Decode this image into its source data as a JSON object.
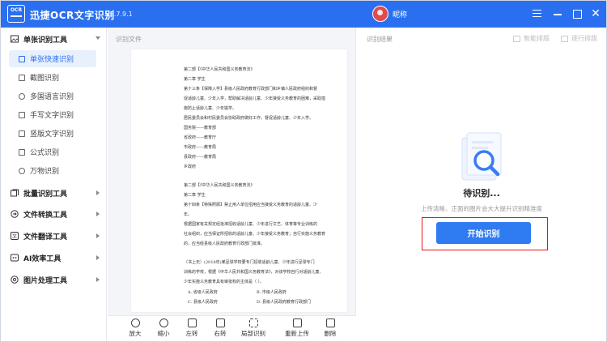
{
  "titlebar": {
    "logo_text": "OCR",
    "title": "迅捷OCR文字识别",
    "version": "v8.7.9.1",
    "nickname": "昵称",
    "controls": [
      "menu-icon",
      "minimize-icon",
      "maximize-icon",
      "close-icon"
    ]
  },
  "sidebar": {
    "groups": [
      {
        "label": "单张识别工具",
        "icon": "image-icon",
        "expanded": true,
        "items": [
          {
            "label": "单张快速识别",
            "icon": "image-icon",
            "active": true
          },
          {
            "label": "截图识别",
            "icon": "crop-icon"
          },
          {
            "label": "多国语言识别",
            "icon": "globe-icon"
          },
          {
            "label": "手写文字识别",
            "icon": "pen-icon"
          },
          {
            "label": "竖版文字识别",
            "icon": "vertical-text-icon"
          },
          {
            "label": "公式识别",
            "icon": "formula-icon"
          },
          {
            "label": "万物识别",
            "icon": "flower-icon"
          }
        ]
      },
      {
        "label": "批量识别工具",
        "icon": "stack-icon",
        "expanded": false
      },
      {
        "label": "文件转换工具",
        "icon": "convert-icon",
        "expanded": false
      },
      {
        "label": "文件翻译工具",
        "icon": "translate-icon",
        "expanded": false
      },
      {
        "label": "AI效率工具",
        "icon": "ai-icon",
        "expanded": false
      },
      {
        "label": "图片处理工具",
        "icon": "picture-icon",
        "expanded": false
      }
    ]
  },
  "center": {
    "label": "识别文件",
    "document_lines": [
      "第二部【《中华人民共和国义务教育法》",
      "第二章  学生",
      "第十三条【保障入学】县级人民政府教育行政部门和乡镇人民政府组织和督",
      "促适龄儿童、少年入学，帮助解决适龄儿童、少年接受义务教育的困难，采取措",
      "施防止适龄儿童、少年辍学。",
      "居民委员会和村民委员会协助政府做好工作，督促适龄儿童、少年入学。",
      "国务院——教育部",
      "省政府——教育厅",
      "市政府——教育局",
      "县政府——教育局",
      "乡政府",
      "第二部【《中华人民共和国义务教育法》",
      "第二章  学生",
      "第十四条【特殊照顾】禁止用人单位招用应当接受义务教育的适龄儿童、少",
      "年。",
      "根据国家有关规定经批准招收适龄儿童、少年进行文艺、体育等专业训练的",
      "社会组织，应当保证所招收的适龄儿童、少年接受义务教育；自行实施义务教育",
      "的，应当经县级人民政府教育行政部门批准。",
      "（书上无）(2018年)某足球学校要专门招收适龄儿童、少年进行足球专门",
      "训练的学校，根据《中华人民共和国义务教育法》，对该学校自行对适龄儿童、",
      "少年实施义务教育具有审批权的主体是（   ）。",
      "A. 省级人民政府",
      "B. 市级人民政府",
      "C. 县级人民政府",
      "D. 县级人民政府教育行政部门"
    ],
    "toolbar": [
      {
        "label": "放大",
        "icon": "zoom-in-icon"
      },
      {
        "label": "缩小",
        "icon": "zoom-out-icon"
      },
      {
        "label": "左转",
        "icon": "rotate-left-icon"
      },
      {
        "label": "右转",
        "icon": "rotate-right-icon"
      },
      {
        "label": "局部识别",
        "icon": "partial-scan-icon"
      },
      {
        "label": "重新上传",
        "icon": "upload-icon"
      },
      {
        "label": "删除",
        "icon": "trash-icon"
      }
    ]
  },
  "right": {
    "label": "识别结果",
    "smart_layout": "智能排版",
    "line_layout": "逐行排版",
    "status": "待识别...",
    "hint": "上传清晰、正面的图片会大大提升识别精准度",
    "start_button": "开始识别"
  },
  "colors": {
    "brand": "#2a6ff0",
    "button": "#2f7bf2",
    "highlight_border": "#e01818"
  }
}
